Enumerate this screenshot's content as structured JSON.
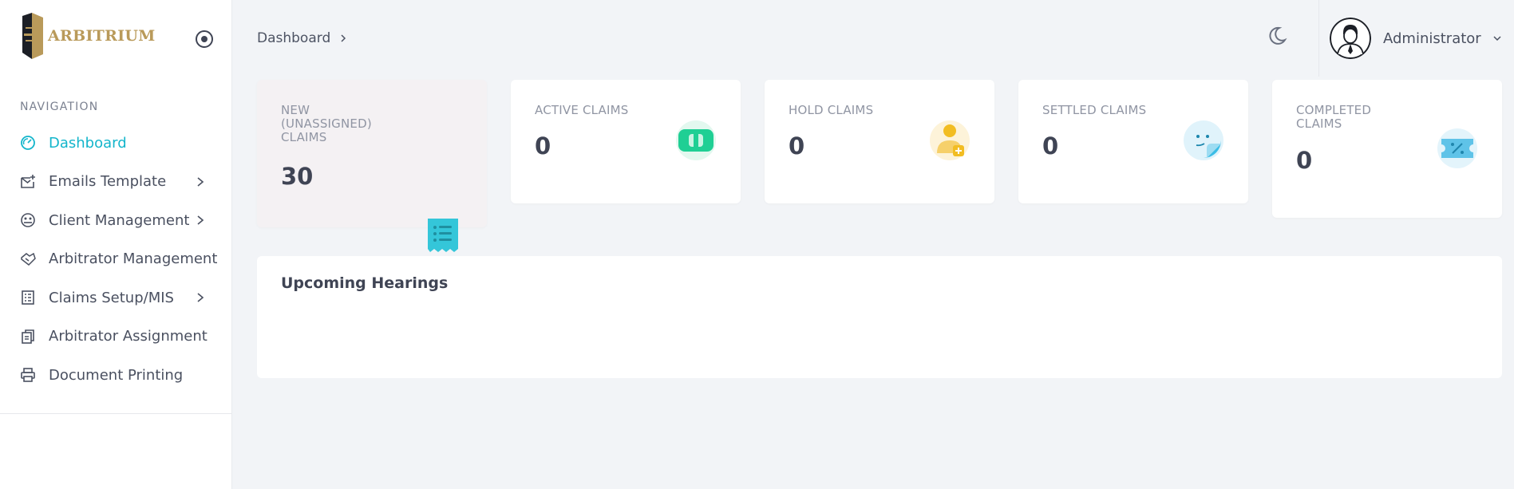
{
  "brand": {
    "name": "ARBITRIUM",
    "accent": "#13b5cb",
    "logo_color": "#b99a5a"
  },
  "sidebar": {
    "heading": "NAVIGATION",
    "items": [
      {
        "label": "Dashboard",
        "icon": "dashboard-gauge-icon",
        "active": true,
        "has_submenu": false
      },
      {
        "label": "Emails Template",
        "icon": "mail-plus-icon",
        "active": false,
        "has_submenu": true
      },
      {
        "label": "Client Management",
        "icon": "users-circle-icon",
        "active": false,
        "has_submenu": true
      },
      {
        "label": "Arbitrator Management",
        "icon": "handshake-icon",
        "active": false,
        "has_submenu": false
      },
      {
        "label": "Claims Setup/MIS",
        "icon": "document-list-icon",
        "active": false,
        "has_submenu": true
      },
      {
        "label": "Arbitrator Assignment",
        "icon": "copy-files-icon",
        "active": false,
        "has_submenu": false
      },
      {
        "label": "Document Printing",
        "icon": "printer-icon",
        "active": false,
        "has_submenu": false
      }
    ]
  },
  "topbar": {
    "breadcrumb": "Dashboard",
    "user": {
      "name": "Administrator"
    }
  },
  "stats": [
    {
      "title": "NEW (UNASSIGNED) CLAIMS",
      "value": "30",
      "icon": "receipt-list-icon",
      "color": "#34c6d9"
    },
    {
      "title": "ACTIVE CLAIMS",
      "value": "0",
      "icon": "money-bill-icon",
      "color": "#1fcf94"
    },
    {
      "title": "HOLD CLAIMS",
      "value": "0",
      "icon": "user-add-icon",
      "color": "#f2bd22"
    },
    {
      "title": "SETTLED CLAIMS",
      "value": "0",
      "icon": "smile-sticker-icon",
      "color": "#3bbde6"
    },
    {
      "title": "COMPLETED CLAIMS",
      "value": "0",
      "icon": "discount-ticket-icon",
      "color": "#5fc3e8"
    }
  ],
  "upcoming_hearings": {
    "title": "Upcoming Hearings"
  }
}
